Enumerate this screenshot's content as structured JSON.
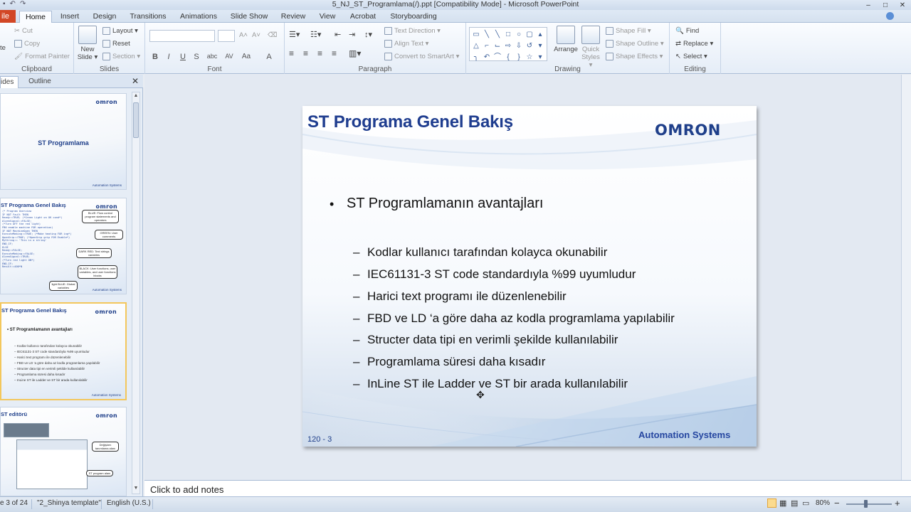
{
  "window": {
    "title": "5_NJ_ST_Programlama(/).ppt [Compatibility Mode] - Microsoft PowerPoint",
    "minimize": "–",
    "maximize": "□",
    "close": "✕"
  },
  "ribbon_tabs": {
    "file": "ile",
    "home": "Home",
    "insert": "Insert",
    "design": "Design",
    "transitions": "Transitions",
    "animations": "Animations",
    "slideshow": "Slide Show",
    "review": "Review",
    "view": "View",
    "acrobat": "Acrobat",
    "storyboarding": "Storyboarding"
  },
  "ribbon": {
    "clipboard": {
      "label": "Clipboard",
      "cut": "Cut",
      "copy": "Copy",
      "format_painter": "Format Painter",
      "paste": "te"
    },
    "slides": {
      "label": "Slides",
      "new_slide": "New",
      "new_slide2": "Slide ▾",
      "layout": "Layout ▾",
      "reset": "Reset",
      "section": "Section ▾"
    },
    "font": {
      "label": "Font",
      "bold": "B",
      "italic": "I",
      "underline": "U",
      "strike": "S",
      "shadow": "abc",
      "spacing": "AV",
      "case": "Aa",
      "color": "A"
    },
    "paragraph": {
      "label": "Paragraph",
      "text_direction": "Text Direction ▾",
      "align_text": "Align Text ▾",
      "smartart": "Convert to SmartArt ▾"
    },
    "drawing": {
      "label": "Drawing",
      "arrange": "Arrange",
      "quick_styles": "Quick",
      "quick_styles2": "Styles ▾",
      "shape_fill": "Shape Fill ▾",
      "shape_outline": "Shape Outline ▾",
      "shape_effects": "Shape Effects ▾"
    },
    "editing": {
      "label": "Editing",
      "find": "Find",
      "replace": "Replace ▾",
      "select": "Select ▾"
    }
  },
  "left_panel": {
    "tab_slides": "ides",
    "tab_outline": "Outline",
    "close": "✕",
    "thumbs": [
      {
        "center_title": "ST Programlama",
        "logo": "omron",
        "footer": "Automation Systems"
      },
      {
        "title": "ST Programa Genel Bakış",
        "logo": "omron",
        "footer": "Automation Systems",
        "code": [
          "(* Program Overview",
          "IF NOT Fault THEN",
          "  Ready:=TRUE; (*Green Light on OK cond*)",
          "  AlarmSignal:=FALSE;",
          "  (*Turn OFF the red light)",
          "    FB0 enable machine FOR operation)",
          "",
          "  IF NOT MachineOpen THEN",
          "    ExecuteMaking:=TRUE; (*Make heating FOR ing*)",
          "    OpenGrip:=TRUE; (*OpenGrip grip FOR Enable*)",
          "    MyString:= 'This is a string'",
          "  END_IF;",
          "ELSE",
          "  Ready:=FALSE;",
          "  ExecuteMaking:=FALSE;",
          "  AlarmSignal:=TRUE;",
          "  (*Turn red light ON*)",
          "END_IF;",
          "",
          "Result:=400*N"
        ],
        "callouts": [
          "BLUE: Flow control program statements and operators",
          "GREEN: User comments",
          "DARK RED: Text strings variables",
          "BLACK: User functions, user variables, and user functions blocks",
          "light BLUE: Global variables"
        ]
      },
      {
        "title": "ST Programa Genel Bakış",
        "logo": "omron",
        "footer": "Automation Systems",
        "bullet": "• ST Programlamanın avantajları",
        "subs": [
          "– Kodlar kullanıcı tarafından kolayca okunabilir",
          "– IEC61131-3 ST code standardıyla %99 uyumludur",
          "– Harici text programı ile düzenlenebilir",
          "– FBD ve LD 'a göre daha az kodla programlama yapılabilir",
          "– Structer data tipi en verimli şekilde kullanılabilir",
          "– Programlama süresi daha kısadır",
          "– InLine ST ile Ladder ve ST bir arada kullanılabilir"
        ]
      },
      {
        "title": "ST editörü",
        "logo": "omron",
        "callouts": [
          "Değişken tanımlama alanı",
          "ST program alanı"
        ]
      }
    ]
  },
  "slide": {
    "title": "ST Programa Genel Bakış",
    "logo": "OMRON",
    "bullet_dot": "•",
    "bullet": "ST Programlamanın avantajları",
    "dash": "–",
    "sub_items": [
      "Kodlar kullanıcı tarafından kolayca okunabilir",
      "IEC61131-3 ST code standardıyla %99 uyumludur",
      "Harici text programı ile düzenlenebilir",
      "FBD ve LD ‘a göre daha az kodla programlama yapılabilir",
      "Structer data tipi en verimli şekilde kullanılabilir",
      "Programlama süresi daha kısadır",
      "InLine ST ile Ladder ve ST bir arada kullanılabilir"
    ],
    "number": "120 - 3",
    "footer": "Automation  Systems"
  },
  "notes": {
    "placeholder": "Click to add notes"
  },
  "status_bar": {
    "slide_counter": "e 3 of 24",
    "template": "\"2_Shinya template\"",
    "language": "English (U.S.)",
    "zoom": "80%",
    "zoom_out": "−",
    "zoom_in": "+"
  }
}
